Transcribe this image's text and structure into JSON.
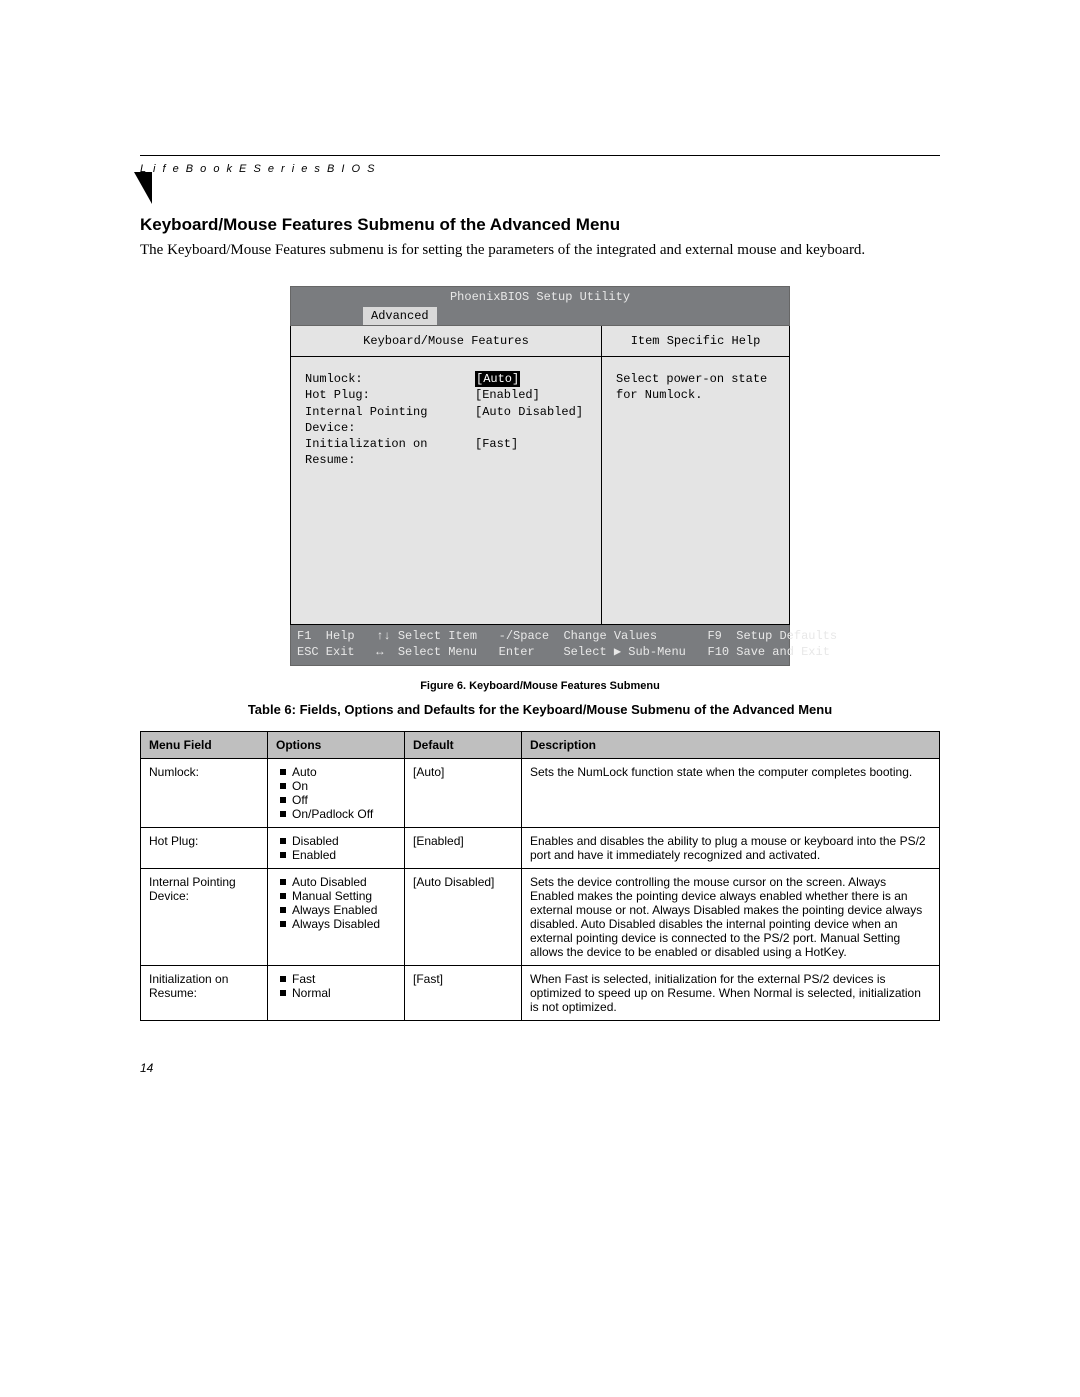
{
  "header": {
    "breadcrumb": "L i f e B o o k   E   S e r i e s   B I O S"
  },
  "title": "Keyboard/Mouse Features Submenu of the Advanced Menu",
  "intro": "The Keyboard/Mouse Features submenu is for setting the parameters of the integrated and external mouse and keyboard.",
  "bios": {
    "utility_title": "PhoenixBIOS Setup Utility",
    "active_tab": "Advanced",
    "left_title": "Keyboard/Mouse Features",
    "right_title": "Item Specific Help",
    "help_text1": "Select power-on state",
    "help_text2": "for Numlock.",
    "rows": [
      {
        "label": "Numlock:",
        "value": "[Auto]",
        "selected": true
      },
      {
        "label": "Hot Plug:",
        "value": "[Enabled]",
        "selected": false
      },
      {
        "label": "Internal Pointing Device:",
        "value": "[Auto Disabled]",
        "selected": false
      },
      {
        "label": "Initialization on Resume:",
        "value": "[Fast]",
        "selected": false
      }
    ],
    "foot_line1": "F1  Help   ↑↓ Select Item   -/Space  Change Values       F9  Setup Defaults",
    "foot_line2": "ESC Exit   ↔  Select Menu   Enter    Select ▶ Sub-Menu   F10 Save and Exit"
  },
  "figure_caption": "Figure 6.  Keyboard/Mouse Features Submenu",
  "table_title": "Table 6: Fields, Options and Defaults for the Keyboard/Mouse Submenu of the Advanced Menu",
  "table": {
    "headers": {
      "c0": "Menu Field",
      "c1": "Options",
      "c2": "Default",
      "c3": "Description"
    },
    "rows": [
      {
        "field": "Numlock:",
        "options": [
          "Auto",
          "On",
          "Off",
          "On/Padlock Off"
        ],
        "default": "[Auto]",
        "desc": "Sets the NumLock function state when the computer completes booting."
      },
      {
        "field": "Hot Plug:",
        "options": [
          "Disabled",
          "Enabled"
        ],
        "default": "[Enabled]",
        "desc": "Enables and disables the ability to plug a mouse or keyboard into the PS/2 port and have it immediately recognized and activated."
      },
      {
        "field": "Internal Pointing Device:",
        "options": [
          "Auto Disabled",
          "Manual Setting",
          "Always Enabled",
          "Always Disabled"
        ],
        "default": "[Auto Disabled]",
        "desc": "Sets the device controlling the mouse cursor on the screen. Always Enabled makes the pointing device always enabled whether there is an external mouse or not. Always Disabled makes the pointing device always disabled. Auto Disabled disables the internal pointing device when an external pointing device is connected to the PS/2 port. Manual Setting allows the device to be enabled or disabled using a HotKey."
      },
      {
        "field": "Initialization on Resume:",
        "options": [
          "Fast",
          "Normal"
        ],
        "default": "[Fast]",
        "desc": "When Fast is selected, initialization for the external PS/2 devices is optimized to speed up on Resume. When Normal is selected, initialization is not optimized."
      }
    ]
  },
  "page_number": "14"
}
